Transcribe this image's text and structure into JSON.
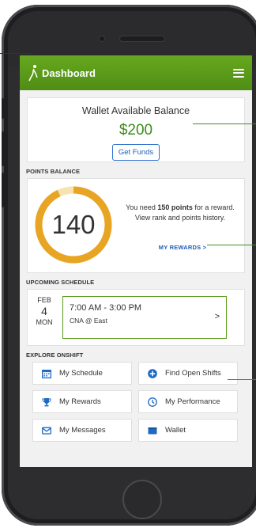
{
  "app": {
    "title": "Dashboard",
    "accent_color": "#5b9a1a",
    "link_color": "#1d5fb8"
  },
  "wallet": {
    "title": "Wallet Available Balance",
    "amount": "$200",
    "button_label": "Get Funds"
  },
  "points": {
    "section_label": "POINTS BALANCE",
    "value": "140",
    "ring_fraction": 0.93,
    "message_prefix": "You need ",
    "message_bold": "150 points",
    "message_suffix": " for a reward. View rank and points history.",
    "link_label": "MY REWARDS >"
  },
  "schedule": {
    "section_label": "UPCOMING SCHEDULE",
    "month": "FEB",
    "day": "4",
    "weekday": "MON",
    "time": "7:00 AM - 3:00 PM",
    "place": "CNA @ East",
    "chevron": ">"
  },
  "explore": {
    "section_label": "EXPLORE ONSHIFT",
    "items": [
      {
        "label": "My Schedule",
        "icon": "calendar-icon"
      },
      {
        "label": "Find Open Shifts",
        "icon": "plus-circle-icon"
      },
      {
        "label": "My Rewards",
        "icon": "trophy-icon"
      },
      {
        "label": "My Performance",
        "icon": "clock-icon"
      },
      {
        "label": "My Messages",
        "icon": "envelope-icon"
      },
      {
        "label": "Wallet",
        "icon": "wallet-icon"
      }
    ]
  }
}
